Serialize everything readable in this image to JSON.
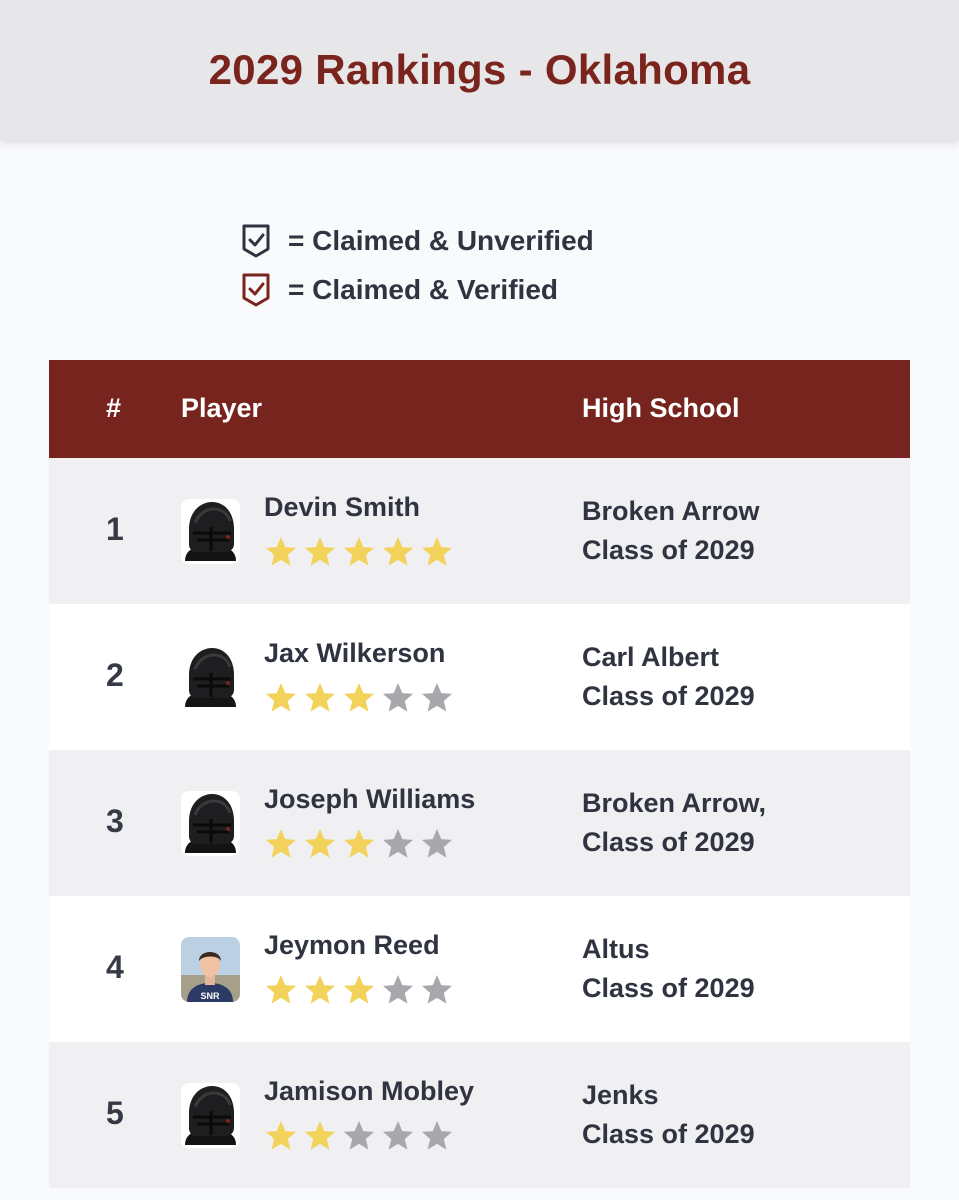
{
  "page": {
    "title": "2029 Rankings - Oklahoma"
  },
  "legend": {
    "unverified": {
      "icon": "shield-check-outline-icon",
      "color": "#2f3440",
      "label": "= Claimed & Unverified"
    },
    "verified": {
      "icon": "shield-check-outline-icon",
      "color": "#7a241d",
      "label": "= Claimed & Verified"
    }
  },
  "table": {
    "headers": {
      "rank": "#",
      "player": "Player",
      "school": "High School"
    },
    "rows": [
      {
        "rank": "1",
        "name": "Devin Smith",
        "stars": 5,
        "avatar": "helmet",
        "school": "Broken Arrow",
        "class": "Class of 2029"
      },
      {
        "rank": "2",
        "name": "Jax Wilkerson",
        "stars": 3,
        "avatar": "helmet",
        "school": "Carl Albert",
        "class": "Class of 2029"
      },
      {
        "rank": "3",
        "name": "Joseph Williams",
        "stars": 3,
        "avatar": "helmet",
        "school": "Broken Arrow,",
        "class": "Class of 2029"
      },
      {
        "rank": "4",
        "name": "Jeymon Reed",
        "stars": 3,
        "avatar": "photo",
        "school": "Altus",
        "class": "Class of 2029"
      },
      {
        "rank": "5",
        "name": "Jamison Mobley",
        "stars": 2,
        "avatar": "helmet",
        "school": "Jenks",
        "class": "Class of 2029"
      }
    ]
  },
  "colors": {
    "accent": "#76241d",
    "star_filled": "#f2d25a",
    "star_empty": "#a7a8ac"
  }
}
